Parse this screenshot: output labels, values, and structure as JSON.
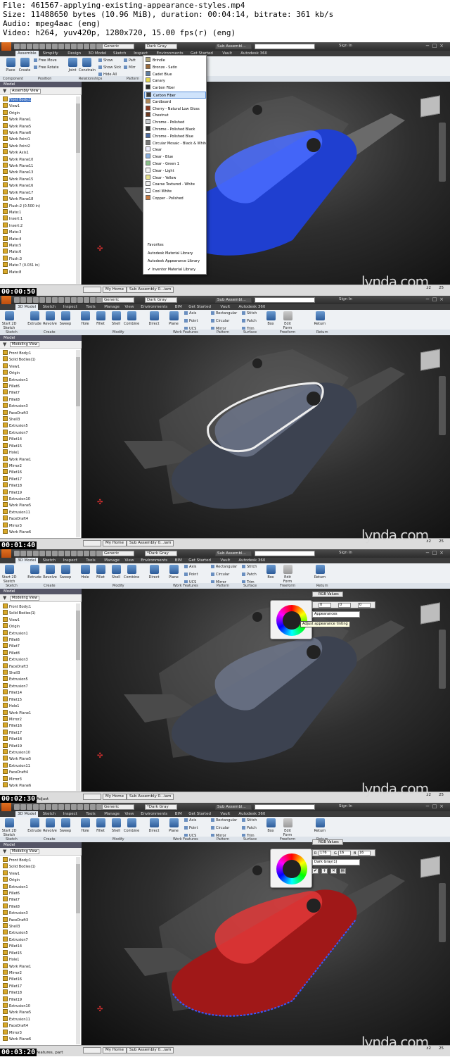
{
  "header": {
    "file": "File: 461567-applying-existing-appearance-styles.mp4",
    "size": "Size: 11488650 bytes (10.96 MiB), duration: 00:04:14, bitrate: 361 kb/s",
    "audio": "Audio: mpeg4aac (eng)",
    "video": "Video: h264, yuv420p, 1280x720, 15.00 fps(r) (eng)"
  },
  "frames": [
    {
      "timestamp": "00:00:50",
      "title": {
        "material": "Generic",
        "appearance": "Dark Gray",
        "doc": "Sub Assembl...",
        "signin": "Sign In"
      },
      "tabs": [
        "Assemble",
        "Simplify",
        "Design",
        "3D Model",
        "Sketch",
        "Inspect",
        "Environments",
        "Get Started",
        "Vault",
        "Autodesk 360"
      ],
      "ribbon": [
        "Place",
        "Create",
        "Free Move",
        "Free Rotate",
        "Joint",
        "Constrain",
        "Show",
        "Show Sick",
        "Hide All",
        "Patt",
        "Mirr"
      ],
      "panels": [
        "Component",
        "Position",
        "Relationships",
        "Pattern"
      ],
      "browser_title": "Model",
      "view_selector": "Assembly View",
      "tree": [
        "Front Body:1",
        "View1",
        "Origin",
        "Work Plane1",
        "Work Plane5",
        "Work Plane6",
        "Work Point1",
        "Work Point2",
        "Work Axis1",
        "Work Plane10",
        "Work Plane11",
        "Work Plane13",
        "Work Plane15",
        "Work Plane16",
        "Work Plane17",
        "Work Plane18",
        "Flush:2 (0.500 in)",
        "Mate:1",
        "Insert:1",
        "Insert:2",
        "Mate:3",
        "Mate:4",
        "Mate:5",
        "Mate:6",
        "Flush:3",
        "Mate:7 (0.031 in)",
        "Mate:8"
      ],
      "status_tabs": [
        "My Home",
        "Sub Assembly 0...iam"
      ],
      "status_nums": [
        "32",
        "25"
      ],
      "status_msg": "",
      "dropdown": {
        "items": [
          {
            "label": "Brindle",
            "color": "#b0a57a"
          },
          {
            "label": "Bronze - Satin",
            "color": "#9a6a3a"
          },
          {
            "label": "Cadet Blue",
            "color": "#5f7d9f"
          },
          {
            "label": "Canary",
            "color": "#e6d84a"
          },
          {
            "label": "Carbon Fiber",
            "color": "#2a2a2a"
          },
          {
            "label": "Carbon Fiber",
            "color": "#3a3a3a"
          },
          {
            "label": "Cardboard",
            "color": "#b08858"
          },
          {
            "label": "Cherry - Natural Low Gloss",
            "color": "#8a3a22"
          },
          {
            "label": "Chestnut",
            "color": "#6a3a22"
          },
          {
            "label": "Chrome - Polished",
            "color": "#c8ccd0"
          },
          {
            "label": "Chrome - Polished Black",
            "color": "#333"
          },
          {
            "label": "Chrome - Polished Blue",
            "color": "#4a6aa0"
          },
          {
            "label": "Circular Mosaic - Black & White",
            "color": "#777"
          },
          {
            "label": "Clear",
            "color": "#eef"
          },
          {
            "label": "Clear - Blue",
            "color": "#8ab0e0"
          },
          {
            "label": "Clear - Green 1",
            "color": "#8ac08a"
          },
          {
            "label": "Clear - Light",
            "color": "#f4f4f4"
          },
          {
            "label": "Clear - Yellow",
            "color": "#e6e08a"
          },
          {
            "label": "Coarse Textured - White",
            "color": "#f0f0f0"
          },
          {
            "label": "Cool White",
            "color": "#f4f8ff"
          },
          {
            "label": "Copper - Polished",
            "color": "#c87a42"
          }
        ],
        "footer": [
          "Favorites",
          "Autodesk Material Library",
          "Autodesk Appearance Library",
          "Inventor Material Library"
        ],
        "checked": "✔"
      }
    },
    {
      "timestamp": "00:01:40",
      "title": {
        "material": "Generic",
        "appearance": "Dark Gray",
        "doc": "Sub Assembl...",
        "signin": "Sign In"
      },
      "tabs": [
        "3D Model",
        "Sketch",
        "Inspect",
        "Tools",
        "Manage",
        "View",
        "Environments",
        "BIM",
        "Get Started",
        "Vault",
        "Autodesk 360"
      ],
      "ribbon": [
        "Start 2D Sketch",
        "Extrude",
        "Revolve",
        "Sweep",
        "Hole",
        "Fillet",
        "Shell",
        "Combine",
        "Direct",
        "Plane",
        "Axis",
        "Point",
        "UCS",
        "Rectangular",
        "Circular",
        "Mirror",
        "Stitch",
        "Patch",
        "Trim",
        "Box",
        "Edit Form",
        "Return"
      ],
      "panels": [
        "Sketch",
        "Create",
        "Modify",
        "Work Features",
        "Pattern",
        "Surface",
        "Freeform",
        "Return"
      ],
      "browser_title": "Model",
      "view_selector": "Modeling View",
      "tree": [
        "Front Body:1",
        "Solid Bodies(1)",
        "View1",
        "Origin",
        "Extrusion1",
        "Fillet6",
        "Fillet7",
        "Fillet8",
        "Extrusion3",
        "FaceDraft3",
        "Shell3",
        "Extrusion5",
        "Extrusion7",
        "Fillet14",
        "Fillet15",
        "Hole1",
        "Work Plane1",
        "Mirror2",
        "Fillet16",
        "Fillet17",
        "Fillet18",
        "Fillet19",
        "Extrusion10",
        "Work Plane5",
        "Extrusion11",
        "FaceDraft4",
        "Mirror3",
        "Work Plane6"
      ],
      "status_tabs": [
        "My Home",
        "Sub Assembly 0...iam"
      ],
      "status_nums": [
        "32",
        "25"
      ],
      "status_msg": ""
    },
    {
      "timestamp": "00:02:30",
      "title": {
        "material": "Generic",
        "appearance": "*Dark Gray",
        "doc": "Sub Assembl...",
        "signin": "Sign In"
      },
      "tabs": [
        "3D Model",
        "Sketch",
        "Inspect",
        "Tools",
        "Manage",
        "View",
        "Environments",
        "BIM",
        "Get Started",
        "Vault",
        "Autodesk 360"
      ],
      "ribbon": [
        "Start 2D Sketch",
        "Extrude",
        "Revolve",
        "Sweep",
        "Hole",
        "Fillet",
        "Shell",
        "Combine",
        "Direct",
        "Plane",
        "Axis",
        "Point",
        "UCS",
        "Rectangular",
        "Circular",
        "Mirror",
        "Stitch",
        "Patch",
        "Trim",
        "Box",
        "Edit Form",
        "Return"
      ],
      "panels": [
        "Sketch",
        "Create",
        "Modify",
        "Work Features",
        "Pattern",
        "Surface",
        "Freeform",
        "Return"
      ],
      "browser_title": "Model",
      "view_selector": "Modeling View",
      "tree": [
        "Front Body:1",
        "Solid Bodies(1)",
        "View1",
        "Origin",
        "Extrusion1",
        "Fillet6",
        "Fillet7",
        "Fillet8",
        "Extrusion3",
        "FaceDraft3",
        "Shell3",
        "Extrusion5",
        "Extrusion7",
        "Fillet14",
        "Fillet15",
        "Hole1",
        "Work Plane1",
        "Mirror2",
        "Fillet16",
        "Fillet17",
        "Fillet18",
        "Fillet19",
        "Extrusion10",
        "Work Plane5",
        "Extrusion11",
        "FaceDraft4",
        "Mirror3",
        "Work Plane6"
      ],
      "status_tabs": [
        "My Home",
        "Sub Assembly 0...iam"
      ],
      "status_nums": [
        "32",
        "25"
      ],
      "status_msg": "Adjust",
      "colorpanel": {
        "mode": "RGB Values",
        "r": "0",
        "g": "0",
        "b": "0",
        "source": "Appearances",
        "tooltip": "Adjust appearance tinting"
      }
    },
    {
      "timestamp": "00:03:20",
      "title": {
        "material": "Generic",
        "appearance": "*Dark Gray",
        "doc": "Sub Assembl...",
        "signin": "Sign In"
      },
      "tabs": [
        "3D Model",
        "Sketch",
        "Inspect",
        "Tools",
        "Manage",
        "View",
        "Environments",
        "BIM",
        "Get Started",
        "Vault",
        "Autodesk 360"
      ],
      "ribbon": [
        "Start 2D Sketch",
        "Extrude",
        "Revolve",
        "Sweep",
        "Hole",
        "Fillet",
        "Shell",
        "Combine",
        "Direct",
        "Plane",
        "Axis",
        "Point",
        "UCS",
        "Rectangular",
        "Circular",
        "Mirror",
        "Stitch",
        "Patch",
        "Trim",
        "Box",
        "Edit Form",
        "Return"
      ],
      "panels": [
        "Sketch",
        "Create",
        "Modify",
        "Work Features",
        "Pattern",
        "Surface",
        "Freeform",
        "Return"
      ],
      "browser_title": "Model",
      "view_selector": "Modeling View",
      "tree": [
        "Front Body:1",
        "Solid Bodies(1)",
        "View1",
        "Origin",
        "Extrusion1",
        "Fillet6",
        "Fillet7",
        "Fillet8",
        "Extrusion3",
        "FaceDraft3",
        "Shell3",
        "Extrusion5",
        "Extrusion7",
        "Fillet14",
        "Fillet15",
        "Hole1",
        "Work Plane1",
        "Mirror2",
        "Fillet16",
        "Fillet17",
        "Fillet18",
        "Fillet19",
        "Extrusion10",
        "Work Plane5",
        "Extrusion11",
        "FaceDraft4",
        "Mirror3",
        "Work Plane6"
      ],
      "status_tabs": [
        "My Home",
        "Sub Assembly 0...iam"
      ],
      "status_nums": [
        "32",
        "25"
      ],
      "status_msg": "features, part",
      "colorpanel": {
        "mode": "RGB Values",
        "r": "176",
        "g": "16",
        "b": "16",
        "source": "Dark Gray(1)",
        "r_label": "R",
        "g_label": "G",
        "b_label": "B"
      }
    }
  ],
  "watermark": "lynda.com",
  "colors": {
    "frame1_body": "#1f3fd0",
    "frame4_body": "#a01818",
    "ui_accent": "#3a6fc2"
  }
}
